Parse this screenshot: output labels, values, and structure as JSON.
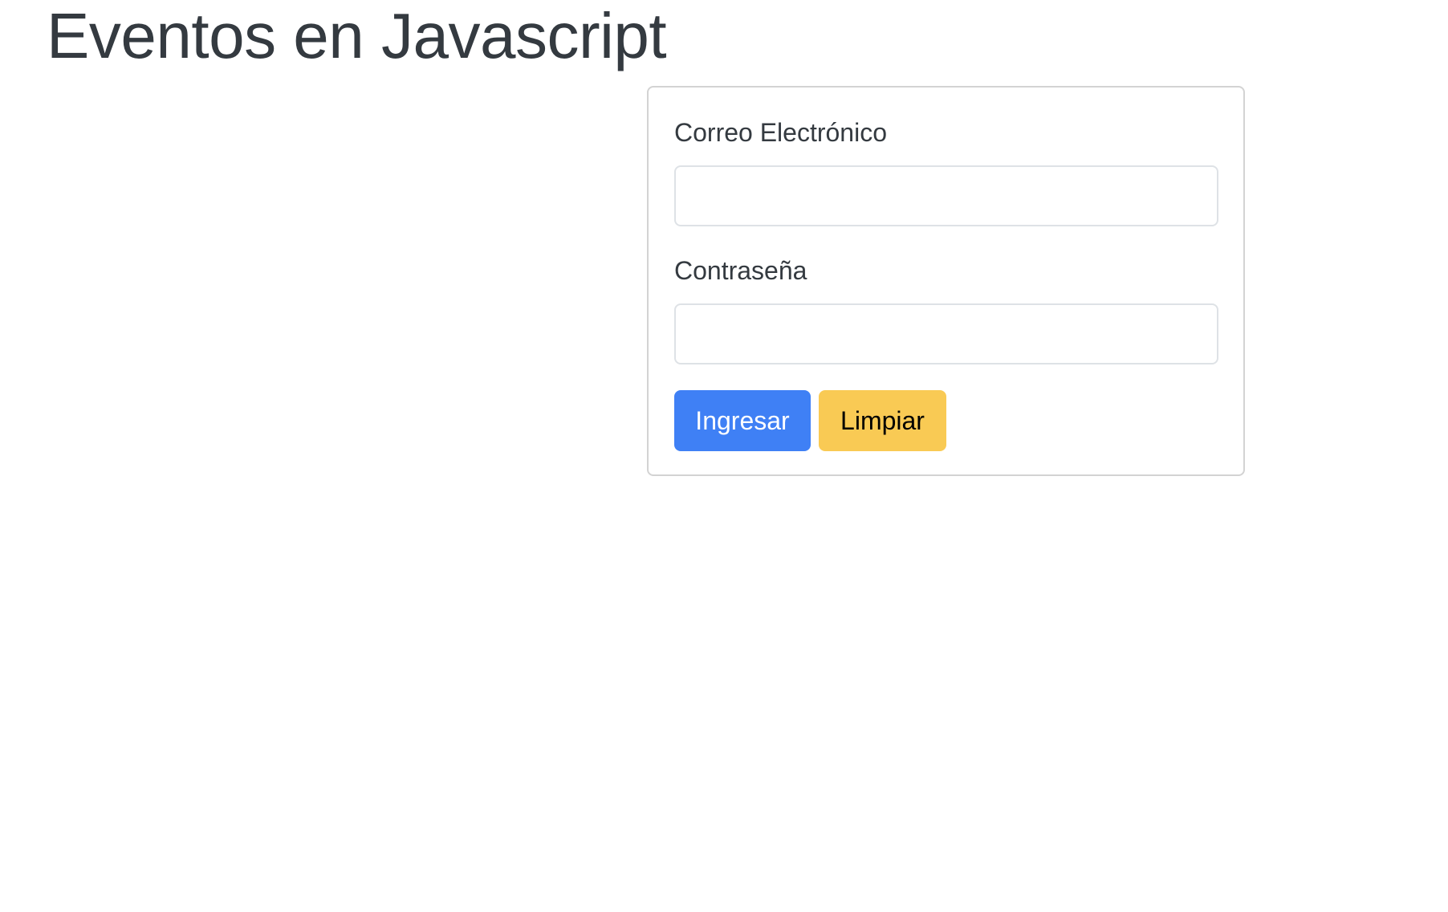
{
  "page": {
    "title": "Eventos en Javascript"
  },
  "form": {
    "email": {
      "label": "Correo Electrónico",
      "value": "",
      "placeholder": ""
    },
    "password": {
      "label": "Contraseña",
      "value": "",
      "placeholder": ""
    },
    "buttons": {
      "submit_label": "Ingresar",
      "clear_label": "Limpiar"
    }
  },
  "colors": {
    "primary": "#3f80f5",
    "warning": "#f9ca54",
    "text": "#343a40",
    "border": "#d3d3d3"
  }
}
